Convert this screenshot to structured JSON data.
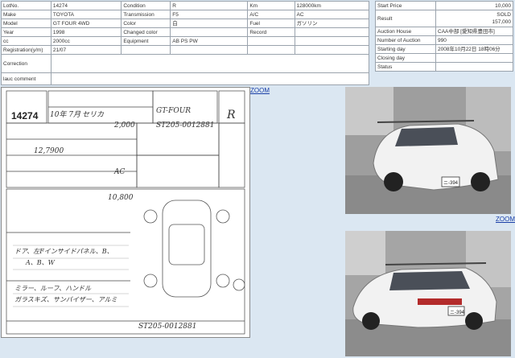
{
  "lot_info": {
    "rows": [
      {
        "l1": "LotNo.",
        "v1": "14274",
        "l2": "Condition",
        "v2": "R",
        "l3": "Km",
        "v3": "128000km"
      },
      {
        "l1": "Make",
        "v1": "TOYOTA",
        "l2": "Transmission",
        "v2": "F5",
        "l3": "A/C",
        "v3": "AC"
      },
      {
        "l1": "Model",
        "v1": "GT FOUR 4WD",
        "l2": "Color",
        "v2": "白",
        "l3": "Fuel",
        "v3": "ガソリン"
      },
      {
        "l1": "Year",
        "v1": "1998",
        "l2": "Changed color",
        "v2": "",
        "l3": "Record",
        "v3": ""
      },
      {
        "l1": "cc",
        "v1": "2000cc",
        "l2": "Equipment",
        "v2": "AB PS PW",
        "l3": "",
        "v3": ""
      },
      {
        "l1": "Registration(y/m)",
        "v1": "21/07",
        "l2": "",
        "v2": "",
        "l3": "",
        "v3": ""
      }
    ],
    "correction_label": "Correction",
    "correction_value": "",
    "comment_label": "lauc comment",
    "comment_value": ""
  },
  "auction_info": {
    "rows": [
      {
        "label": "Start Price",
        "value": "10,000"
      },
      {
        "label": "Result",
        "value": "SOLD\n157,000"
      },
      {
        "label": "Auction House",
        "value": "CAA中部 [愛知県豊田市]"
      },
      {
        "label": "Number of Auction",
        "value": "990"
      },
      {
        "label": "Starting day",
        "value": "2008年10月22日 18時06分"
      },
      {
        "label": "Closing day",
        "value": ""
      },
      {
        "label": "Status",
        "value": ""
      }
    ]
  },
  "zoom_labels": [
    "ZOOM",
    "ZOOM"
  ],
  "sheet": {
    "lot_number": "14274",
    "model_hand": "セリカ",
    "grade_hand": "GT-FOUR",
    "score_hand": "R",
    "chassis_hand": "ST205-0012881",
    "cc_hand": "2,000",
    "ac_hand": "AC",
    "year_hand": "10年 7月",
    "mileage_hand": "12,7900",
    "notes_hand_1": "ドア、左Fインサイドパネル、B、",
    "notes_hand_2": "A、B、W",
    "notes_hand_3": "ミラー、ルーフ、ハンドル",
    "notes_hand_4": "ガラスキズ、サンバイザー、アルミ",
    "price_hand": "10,800"
  },
  "photos": [
    {
      "name": "front-photo",
      "plate": "ニ-394"
    },
    {
      "name": "rear-photo",
      "plate": "ニ-394"
    }
  ],
  "colors": {
    "background": "#dbe7f2",
    "link": "#1a3fa8",
    "car": "#f2f2f2"
  }
}
